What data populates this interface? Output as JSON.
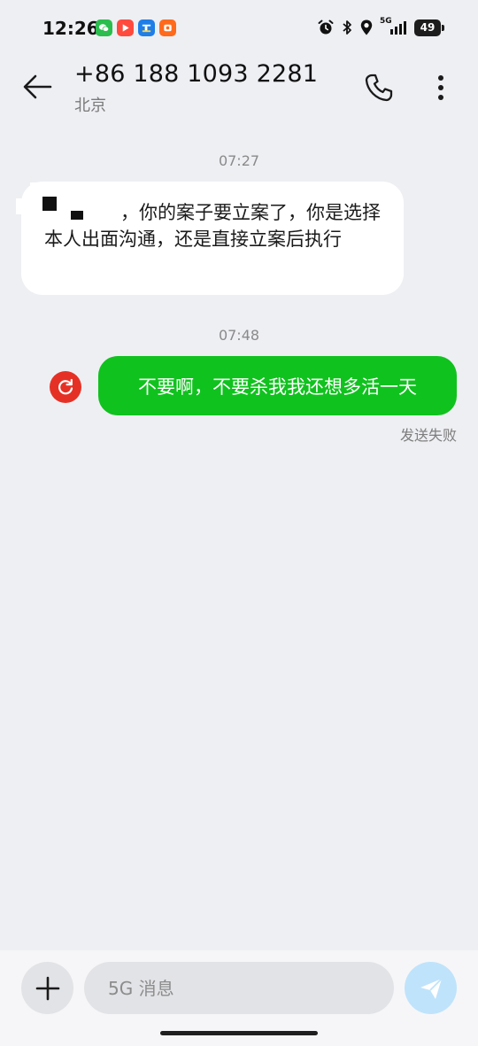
{
  "status_bar": {
    "time": "12:26",
    "network_label": "5G",
    "battery": "49",
    "app_icons": [
      "wechat-icon",
      "video-app-icon",
      "bank-app-icon",
      "shop-app-icon"
    ],
    "system_icons": [
      "alarm-icon",
      "bluetooth-icon",
      "location-icon",
      "signal-icon",
      "battery-icon"
    ]
  },
  "header": {
    "contact_number": "+86 188 1093 2281",
    "contact_location": "北京"
  },
  "messages": [
    {
      "timestamp": "07:27",
      "direction": "incoming",
      "text": "，你的案子要立案了，你是选择本人出面沟通，还是直接立案后执行"
    },
    {
      "timestamp": "07:48",
      "direction": "outgoing",
      "text": "不要啊，不要杀我我还想多活一天",
      "status": "发送失败"
    }
  ],
  "composer": {
    "placeholder": "5G 消息"
  },
  "colors": {
    "background": "#eeeff3",
    "incoming_bubble": "#ffffff",
    "outgoing_bubble": "#10c21e",
    "retry_icon": "#e53125",
    "send_button": "#bfe3fb"
  }
}
